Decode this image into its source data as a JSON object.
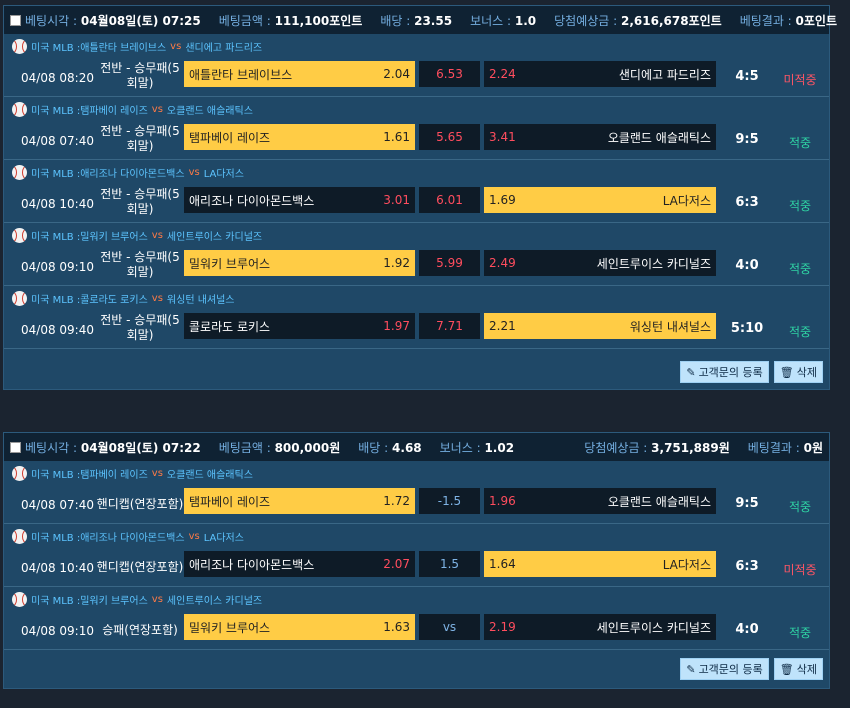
{
  "labels": {
    "bet_time": "베팅시각 : ",
    "bet_amount": "베팅금액 : ",
    "odds": "배당 : ",
    "bonus": "보너스 : ",
    "expected": "당첨예상금 : ",
    "result": "베팅결과 : ",
    "vs": "vs",
    "inquiry_button": "고객문의 등록",
    "delete_button": "삭제"
  },
  "tickets": [
    {
      "bet_time": "04월08일(토) 07:25",
      "bet_amount": "111,100포인트",
      "odds": "23.55",
      "bonus": "1.0",
      "expected": "2,616,678포인트",
      "result": "0포인트",
      "games": [
        {
          "league": "미국 MLB : ",
          "home": "애틀란타 브레이브스",
          "away": "샌디에고 파드리즈",
          "date": "04/08 08:20",
          "type": "전반 - 승무패(5회말)",
          "odd_home": "2.04",
          "mid": "6.53",
          "odd_away": "2.24",
          "score": "4:5",
          "result": "미적중",
          "selected": "home"
        },
        {
          "league": "미국 MLB : ",
          "home": "탬파베이 레이즈",
          "away": "오클랜드 애슬래틱스",
          "date": "04/08 07:40",
          "type": "전반 - 승무패(5회말)",
          "odd_home": "1.61",
          "mid": "5.65",
          "odd_away": "3.41",
          "score": "9:5",
          "result": "적중",
          "selected": "home"
        },
        {
          "league": "미국 MLB : ",
          "home": "애리조나 다이아몬드백스",
          "away": "LA다저스",
          "date": "04/08 10:40",
          "type": "전반 - 승무패(5회말)",
          "odd_home": "3.01",
          "mid": "6.01",
          "odd_away": "1.69",
          "score": "6:3",
          "result": "적중",
          "selected": "away"
        },
        {
          "league": "미국 MLB : ",
          "home": "밀워키 브루어스",
          "away": "세인트루이스 카디널즈",
          "date": "04/08 09:10",
          "type": "전반 - 승무패(5회말)",
          "odd_home": "1.92",
          "mid": "5.99",
          "odd_away": "2.49",
          "score": "4:0",
          "result": "적중",
          "selected": "home"
        },
        {
          "league": "미국 MLB : ",
          "home": "콜로라도 로키스",
          "away": "워싱턴 내셔널스",
          "date": "04/08 09:40",
          "type": "전반 - 승무패(5회말)",
          "odd_home": "1.97",
          "mid": "7.71",
          "odd_away": "2.21",
          "score": "5:10",
          "result": "적중",
          "selected": "away"
        }
      ]
    },
    {
      "bet_time": "04월08일(토) 07:22",
      "bet_amount": "800,000원",
      "odds": "4.68",
      "bonus": "1.02",
      "expected": "3,751,889원",
      "result": "0원",
      "games": [
        {
          "league": "미국 MLB : ",
          "home": "탬파베이 레이즈",
          "away": "오클랜드 애슬래틱스",
          "date": "04/08 07:40",
          "type": "핸디캡(연장포함)",
          "odd_home": "1.72",
          "mid": "-1.5",
          "odd_away": "1.96",
          "score": "9:5",
          "result": "적중",
          "selected": "home"
        },
        {
          "league": "미국 MLB : ",
          "home": "애리조나 다이아몬드백스",
          "away": "LA다저스",
          "date": "04/08 10:40",
          "type": "핸디캡(연장포함)",
          "odd_home": "2.07",
          "mid": "1.5",
          "odd_away": "1.64",
          "score": "6:3",
          "result": "미적중",
          "selected": "away"
        },
        {
          "league": "미국 MLB : ",
          "home": "밀워키 브루어스",
          "away": "세인트루이스 카디널즈",
          "date": "04/08 09:10",
          "type": "승패(연장포함)",
          "odd_home": "1.63",
          "mid": "vs",
          "odd_away": "2.19",
          "score": "4:0",
          "result": "적중",
          "selected": "home"
        }
      ]
    }
  ]
}
